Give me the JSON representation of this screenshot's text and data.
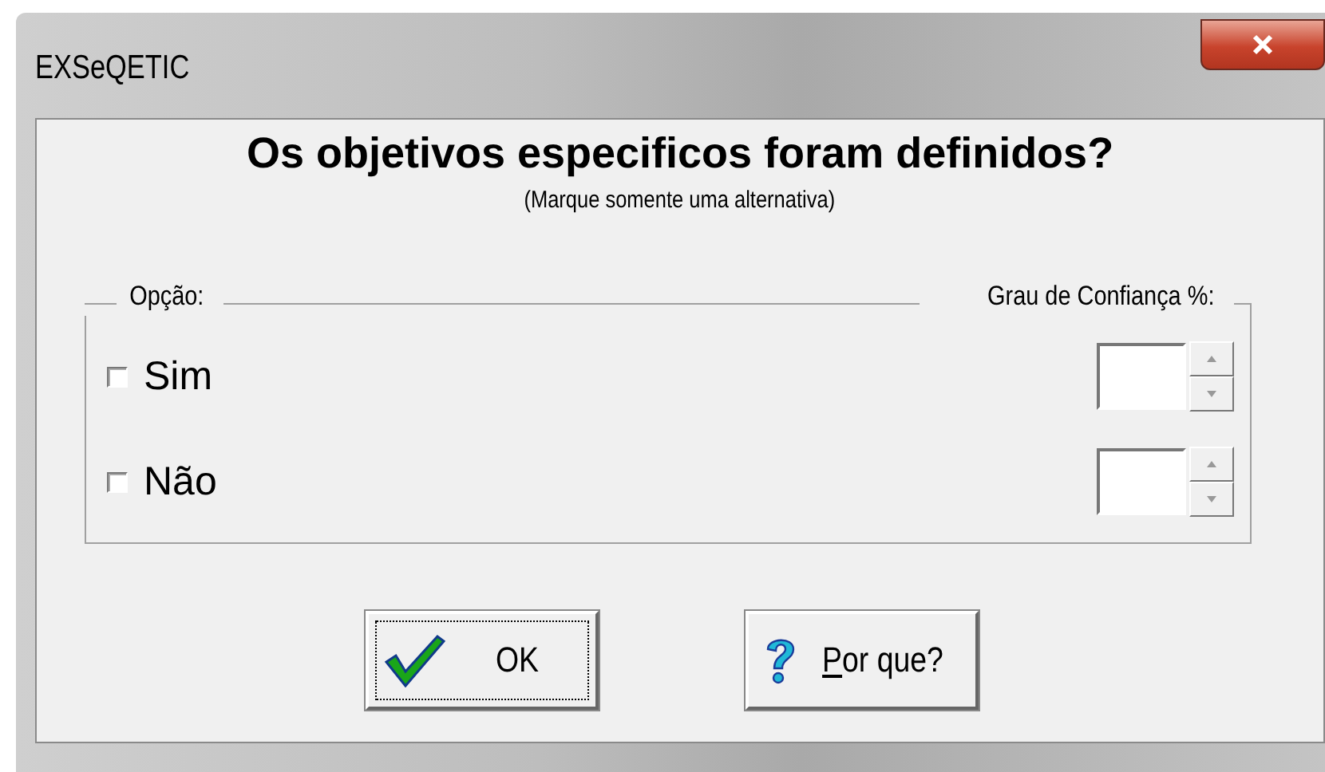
{
  "window": {
    "title": "EXSeQETIC"
  },
  "question": "Os objetivos especificos foram definidos?",
  "hint": "(Marque somente uma alternativa)",
  "group": {
    "option_label": "Opção:",
    "confidence_label": "Grau de Confiança %:"
  },
  "options": [
    {
      "label": "Sim",
      "checked": false
    },
    {
      "label": "Não",
      "checked": false
    }
  ],
  "buttons": [
    {
      "kind": "ok",
      "label": "OK",
      "focused": true
    },
    {
      "kind": "help",
      "label_parts": [
        {
          "text": "P",
          "underlined": true
        },
        {
          "text": "or que?",
          "underlined": false
        }
      ],
      "focused": false
    }
  ]
}
